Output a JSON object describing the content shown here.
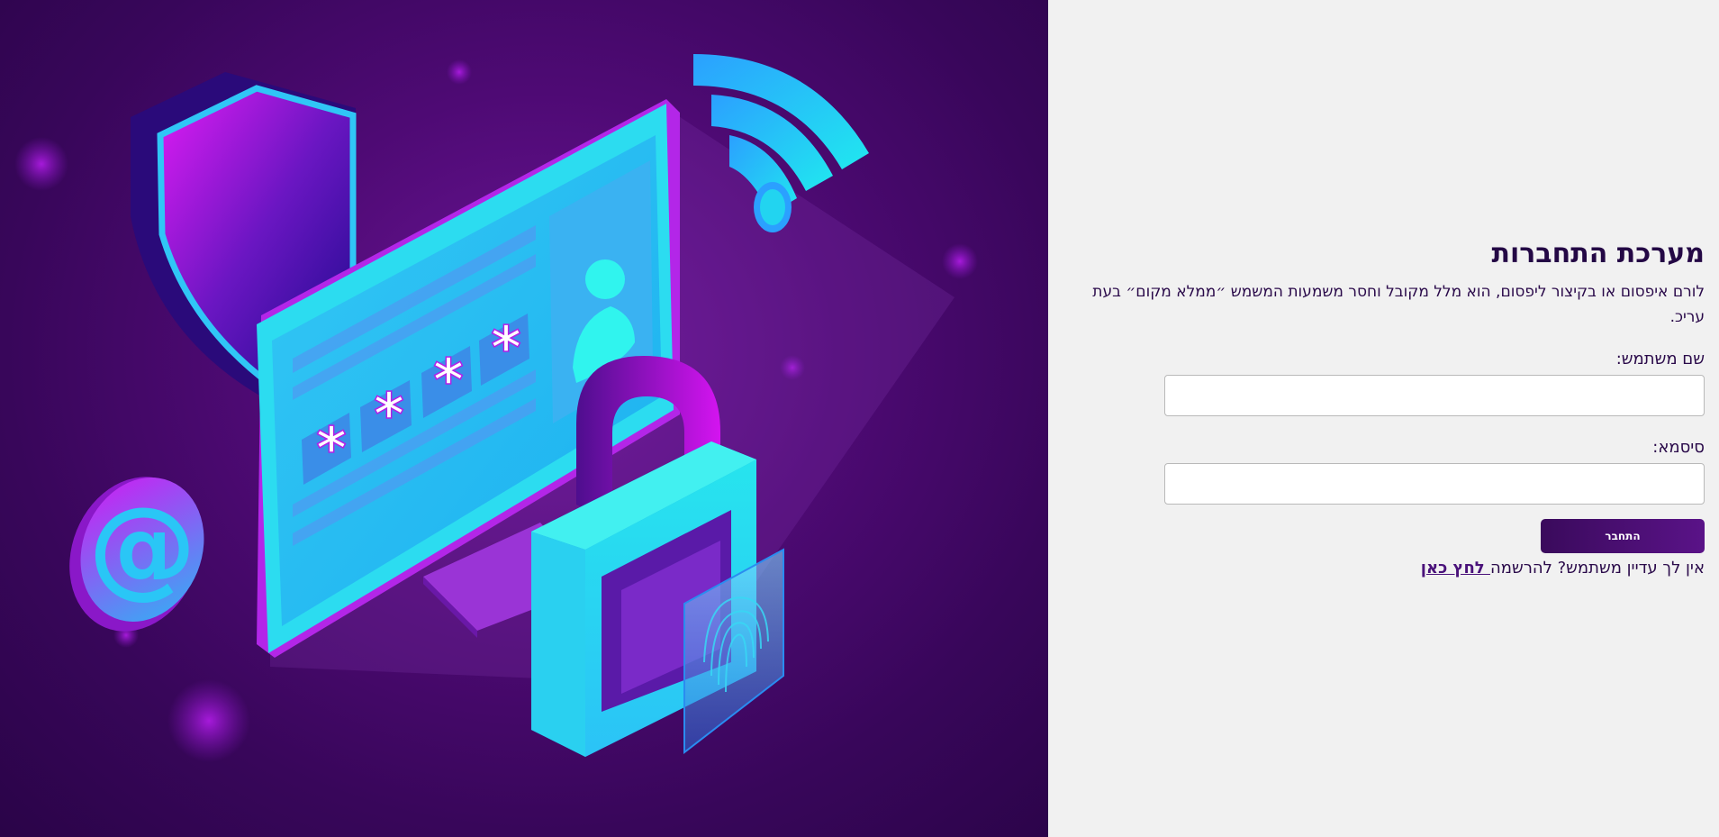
{
  "login": {
    "title": "מערכת התחברות",
    "description": "לורם איפסום או בקיצור ליפסום, הוא מלל מקובל וחסר משמעות המשמש ״ממלא מקום״ בעת עריכ.",
    "username_label": "שם משתמש:",
    "username_value": "",
    "password_label": "סיסמא:",
    "password_value": "",
    "submit_label": "התחבר",
    "register_prompt": "אין לך עדיין משתמש? להרשמה",
    "register_link": " לחץ כאן"
  },
  "colors": {
    "accent": "#4a127a",
    "button": "#3a0a5c",
    "panel_bg": "#f1f1f1",
    "hero_bg": "#4e0a74",
    "cyan": "#22d6ee",
    "magenta": "#d414f0"
  },
  "illustration": {
    "icons": [
      "shield-icon",
      "computer-monitor-icon",
      "password-field-icon",
      "user-profile-icon",
      "padlock-icon",
      "fingerprint-icon",
      "wifi-icon",
      "at-sign-icon"
    ]
  }
}
